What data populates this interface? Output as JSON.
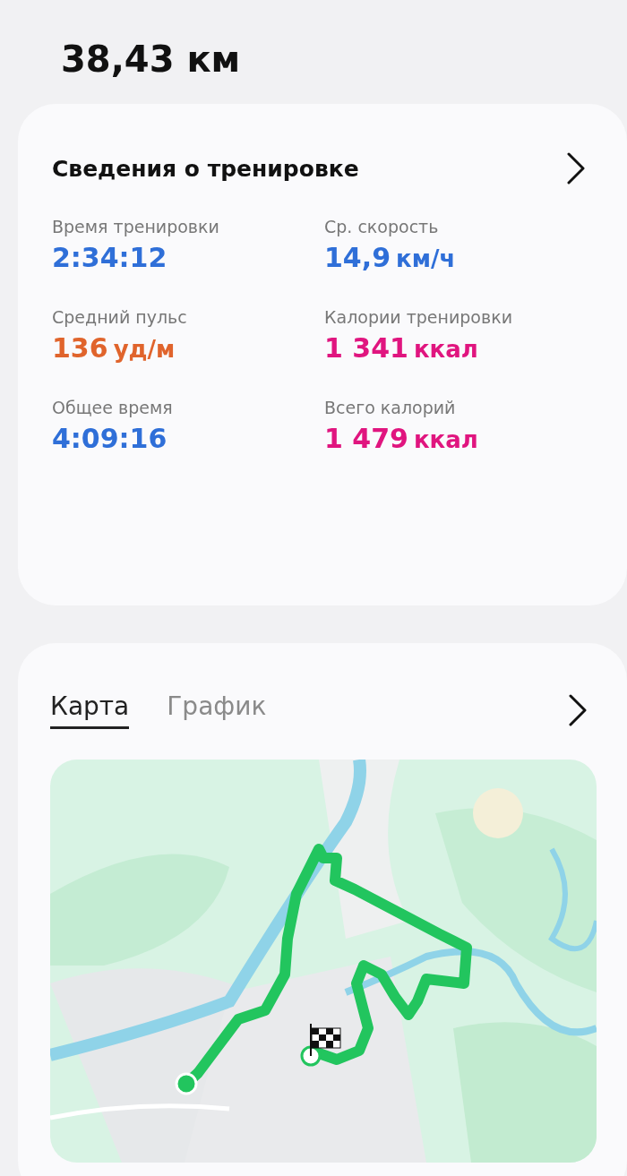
{
  "distance": "38,43 км",
  "summary": {
    "title": "Сведения о тренировке",
    "stats": [
      {
        "label": "Время тренировки",
        "value": "2:34:12",
        "color": "#2f6fd8"
      },
      {
        "label": "Ср. скорость",
        "value": "14,9",
        "unit": "км/ч",
        "color": "#2f6fd8"
      },
      {
        "label": "Средний пульс",
        "value": "136",
        "unit": "уд/м",
        "color": "#e0642c"
      },
      {
        "label": "Калории тренировки",
        "value": "1 341",
        "unit": "ккал",
        "color": "#e0157f"
      },
      {
        "label": "Общее время",
        "value": "4:09:16",
        "color": "#2f6fd8"
      },
      {
        "label": "Всего калорий",
        "value": "1 479",
        "unit": "ккал",
        "color": "#e0157f"
      }
    ]
  },
  "map_card": {
    "tabs": [
      {
        "label": "Карта",
        "selected": true
      },
      {
        "label": "График",
        "selected": false
      }
    ]
  }
}
